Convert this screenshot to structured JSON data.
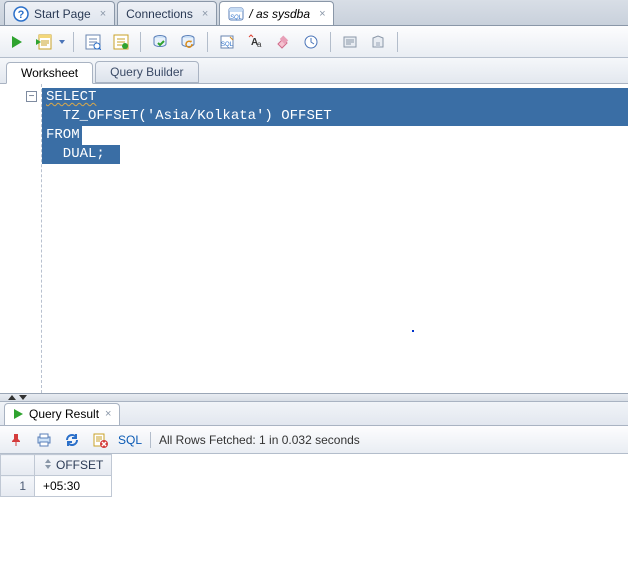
{
  "top_tabs": {
    "start_page": "Start Page",
    "connections": "Connections",
    "sysdba": "/ as sysdba"
  },
  "sub_tabs": {
    "worksheet": "Worksheet",
    "query_builder": "Query Builder"
  },
  "code": {
    "l1": "SELECT",
    "l2": "  TZ_OFFSET('Asia/Kolkata') OFFSET",
    "l3": "FROM",
    "l4": "  DUAL;"
  },
  "result_tab": {
    "label": "Query Result"
  },
  "result_toolbar": {
    "sql_link": "SQL",
    "status": "All Rows Fetched: 1 in 0.032 seconds"
  },
  "grid": {
    "col1": "OFFSET",
    "row1_num": "1",
    "row1_val": "+05:30"
  },
  "fold_symbol": "−"
}
